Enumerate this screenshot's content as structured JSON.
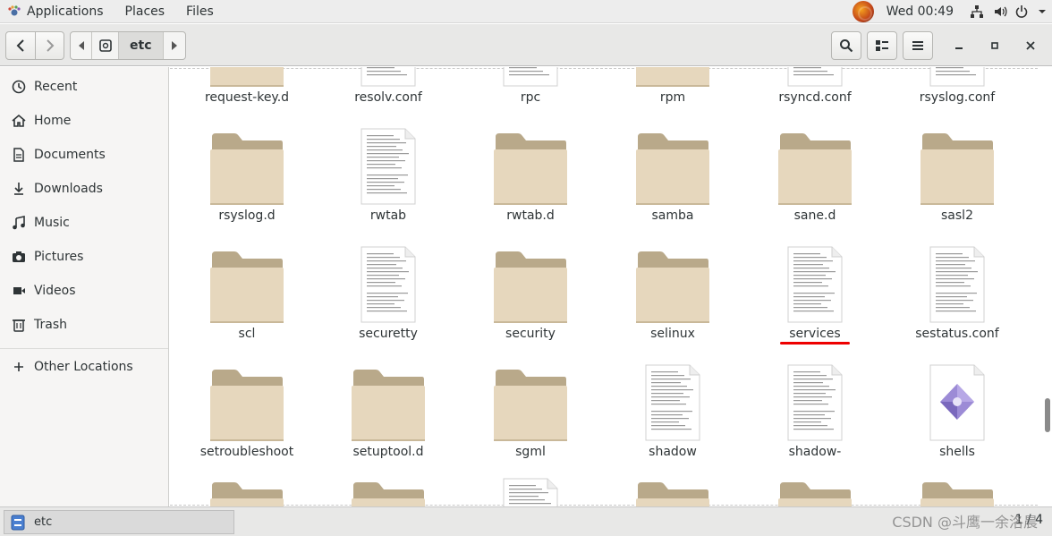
{
  "topbar": {
    "applications": "Applications",
    "places": "Places",
    "files": "Files",
    "clock": "Wed 00:49"
  },
  "headerbar": {
    "path_current": "etc"
  },
  "sidebar": {
    "items": [
      {
        "label": "Recent",
        "icon": "clock-icon"
      },
      {
        "label": "Home",
        "icon": "home-icon"
      },
      {
        "label": "Documents",
        "icon": "document-icon"
      },
      {
        "label": "Downloads",
        "icon": "download-icon"
      },
      {
        "label": "Music",
        "icon": "music-icon"
      },
      {
        "label": "Pictures",
        "icon": "camera-icon"
      },
      {
        "label": "Videos",
        "icon": "video-icon"
      },
      {
        "label": "Trash",
        "icon": "trash-icon"
      },
      {
        "label": "Other Locations",
        "icon": "plus-icon"
      }
    ]
  },
  "files": {
    "row0": [
      "request-key.d",
      "resolv.conf",
      "rpc",
      "rpm",
      "rsyncd.conf",
      "rsyslog.conf"
    ],
    "row1": [
      "rsyslog.d",
      "rwtab",
      "rwtab.d",
      "samba",
      "sane.d",
      "sasl2"
    ],
    "row2": [
      "scl",
      "securetty",
      "security",
      "selinux",
      "services",
      "sestatus.conf"
    ],
    "row3": [
      "setroubleshoot",
      "setuptool.d",
      "sgml",
      "shadow",
      "shadow-",
      "shells"
    ]
  },
  "statusbar": {
    "task_label": "etc",
    "pager": "1 / 4",
    "watermark": "CSDN @斗鹰一余洛晨"
  }
}
